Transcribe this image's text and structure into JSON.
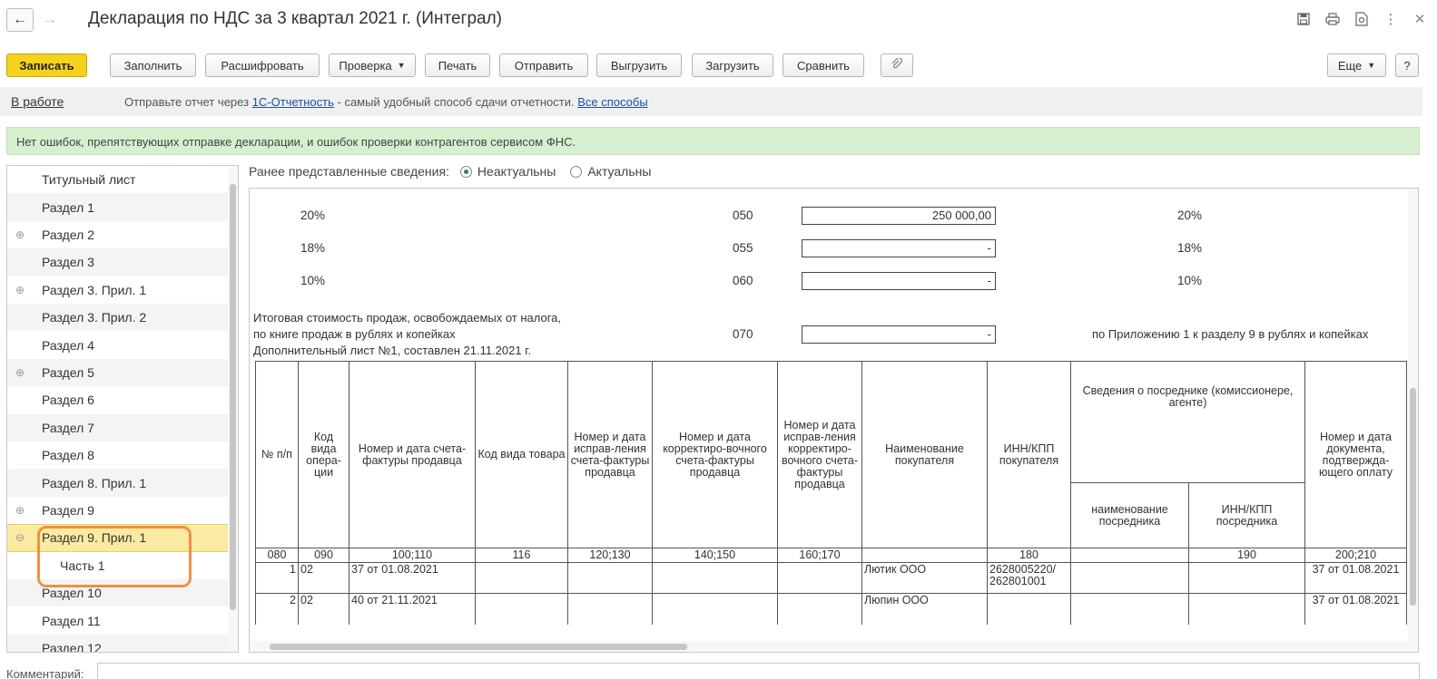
{
  "window": {
    "title": "Декларация по НДС за 3 квартал 2021 г. (Интеграл)",
    "icons": [
      "back-arrow",
      "forward-arrow",
      "save-disk",
      "print",
      "preview",
      "more-vertical",
      "close"
    ]
  },
  "toolbar": {
    "save": "Записать",
    "fill": "Заполнить",
    "decode": "Расшифровать",
    "check": "Проверка",
    "print": "Печать",
    "send": "Отправить",
    "export": "Выгрузить",
    "import": "Загрузить",
    "compare": "Сравнить",
    "more": "Еще",
    "help": "?"
  },
  "status": {
    "state": "В работе",
    "msg_prefix": "Отправьте отчет через",
    "msg_link": "1С-Отчетность",
    "msg_middle": "- самый удобный способ сдачи отчетности.",
    "msg_link2": "Все способы"
  },
  "banner": {
    "text": "Нет ошибок, препятствующих отправке декларации, и ошибок проверки контрагентов сервисом ФНС."
  },
  "nav": {
    "items": [
      {
        "label": "Титульный лист",
        "expand": ""
      },
      {
        "label": "Раздел 1",
        "expand": ""
      },
      {
        "label": "Раздел 2",
        "expand": "⊕"
      },
      {
        "label": "Раздел 3",
        "expand": ""
      },
      {
        "label": "Раздел 3. Прил. 1",
        "expand": "⊕"
      },
      {
        "label": "Раздел 3. Прил. 2",
        "expand": ""
      },
      {
        "label": "Раздел 4",
        "expand": ""
      },
      {
        "label": "Раздел 5",
        "expand": "⊕"
      },
      {
        "label": "Раздел 6",
        "expand": ""
      },
      {
        "label": "Раздел 7",
        "expand": ""
      },
      {
        "label": "Раздел 8",
        "expand": ""
      },
      {
        "label": "Раздел 8. Прил. 1",
        "expand": ""
      },
      {
        "label": "Раздел 9",
        "expand": "⊕"
      },
      {
        "label": "Раздел 9. Прил. 1",
        "expand": "⊖"
      },
      {
        "label": "Часть 1",
        "expand": ""
      },
      {
        "label": "Раздел 10",
        "expand": ""
      },
      {
        "label": "Раздел 11",
        "expand": ""
      },
      {
        "label": "Раздел 12",
        "expand": ""
      }
    ],
    "selected": "Раздел 9. Прил. 1"
  },
  "prior": {
    "label": "Ранее представленные сведения:",
    "opt1": "Неактуальны",
    "opt2": "Актуальны"
  },
  "form": {
    "r20": {
      "left": "20%",
      "code": "050",
      "value": "250 000,00",
      "right": "20%"
    },
    "r18": {
      "left": "18%",
      "code": "055",
      "value": "-",
      "right": "18%"
    },
    "r10": {
      "left": "10%",
      "code": "060",
      "value": "-",
      "right": "10%"
    },
    "total_text1": "Итоговая стоимость продаж, освобождаемых от налога,",
    "total_text2": "по книге продаж в рублях и копейках",
    "total_code": "070",
    "total_value": "-",
    "total_right": "по Приложению 1 к разделу 9 в рублях и копейках",
    "sheet": "Дополнительный лист №1, составлен 21.11.2021 г."
  },
  "table": {
    "headers": {
      "num": "№ п/п",
      "op": "Код вида опера-ции",
      "inv": "Номер и дата счета-фактуры продавца",
      "goods": "Код вида товара",
      "fix": "Номер и дата исправ-ления счета-фактуры продавца",
      "corr": "Номер и дата корректиро-вочного счета-фактуры продавца",
      "fixcorr": "Номер и дата исправ-ления корректиро-вочного счета-фактуры продавца",
      "buyer": "Наименование покупателя",
      "inn": "ИНН/КПП покупателя",
      "agent": "Сведения о посреднике (комиссионере, агенте)",
      "agent_name": "наименование посредника",
      "agent_inn": "ИНН/КПП посредника",
      "payment": "Номер и дата документа, подтвержда-ющего оплату"
    },
    "codes": [
      "080",
      "090",
      "100;110",
      "116",
      "120;130",
      "140;150",
      "160;170",
      "",
      "180",
      "",
      "190",
      "200;210"
    ],
    "rows": [
      {
        "num": "1",
        "op": "02",
        "inv": "37 от 01.08.2021",
        "goods": "",
        "fix": "",
        "corr": "",
        "fixcorr": "",
        "buyer": "Лютик ООО",
        "inn": "2628005220/ 262801001",
        "agent_name": "",
        "agent_inn": "",
        "payment": "37 от 01.08.2021"
      },
      {
        "num": "2",
        "op": "02",
        "inv": "40 от 21.11.2021",
        "goods": "",
        "fix": "",
        "corr": "",
        "fixcorr": "",
        "buyer": "Люпин ООО",
        "inn": "",
        "agent_name": "",
        "agent_inn": "",
        "payment": "37 от 01.08.2021"
      }
    ]
  },
  "comment": {
    "label": "Комментарий:"
  },
  "colors": {
    "primary": "#f6d11d",
    "banner": "#d6f0cf",
    "selected": "#fbeaa1",
    "highlight": "#f09043",
    "link": "#1b4fa5"
  }
}
